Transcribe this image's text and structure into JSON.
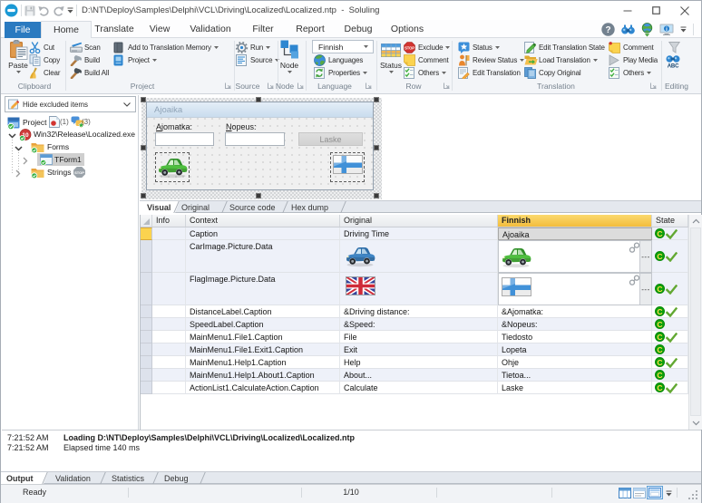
{
  "titlebar": {
    "document_path": "D:\\NT\\Deploy\\Samples\\Delphi\\VCL\\Driving\\Localized\\Localized.ntp",
    "separator": "-",
    "app_name": "Soluling",
    "qat_icons": [
      "app-logo",
      "save",
      "undo",
      "redo",
      "dropdown"
    ],
    "window_buttons": [
      "minimize",
      "maximize",
      "close"
    ]
  },
  "ribbon_tabs": {
    "items": [
      "File",
      "Home",
      "Translate",
      "View",
      "Validation",
      "Filter",
      "Report",
      "Debug",
      "Options"
    ],
    "active": "Home",
    "file_tab_color": "#2a7ac0",
    "right_icons": [
      "help",
      "find",
      "web",
      "remote-desktop",
      "dropdown"
    ]
  },
  "ribbon": {
    "groups": [
      {
        "label": "Clipboard",
        "has_launcher": false,
        "big": [
          {
            "label": "Paste",
            "icon": "paste",
            "caret": true
          }
        ],
        "buttons": [
          {
            "label": "Cut",
            "icon": "cut"
          },
          {
            "label": "Copy",
            "icon": "copy"
          },
          {
            "label": "Clear",
            "icon": "clear"
          }
        ]
      },
      {
        "label": "Project",
        "has_launcher": true,
        "buttons": [
          {
            "label": "Scan",
            "icon": "scan"
          },
          {
            "label": "Build",
            "icon": "build"
          },
          {
            "label": "Build All",
            "icon": "buildall"
          },
          {
            "label": "Add to Translation Memory",
            "icon": "tmem",
            "caret": true
          },
          {
            "label": "Project",
            "icon": "project",
            "caret": true
          }
        ]
      },
      {
        "label": "Source",
        "has_launcher": true,
        "buttons": [
          {
            "label": "Run",
            "icon": "run",
            "caret": true
          },
          {
            "label": "Source",
            "icon": "source",
            "caret": true
          }
        ]
      },
      {
        "label": "Node",
        "has_launcher": true,
        "big": [
          {
            "label": "Node",
            "icon": "node",
            "caret": true
          }
        ],
        "buttons": []
      },
      {
        "label": "Language",
        "has_launcher": true,
        "combo": {
          "value": "Finnish"
        },
        "buttons": [
          {
            "label": "Languages",
            "icon": "globe"
          },
          {
            "label": "Properties",
            "icon": "properties",
            "caret": true
          }
        ]
      },
      {
        "label": "Row",
        "has_launcher": true,
        "big": [
          {
            "label": "Status",
            "icon": "statusgrid",
            "caret": true
          }
        ],
        "buttons": [
          {
            "label": "Exclude",
            "icon": "exclude",
            "caret": true
          },
          {
            "label": "Comment",
            "icon": "comment"
          },
          {
            "label": "Others",
            "icon": "others",
            "caret": true
          }
        ]
      },
      {
        "label": "Translation",
        "has_launcher": true,
        "buttons": [
          {
            "label": "Status",
            "icon": "tstatus",
            "caret": true
          },
          {
            "label": "Review Status",
            "icon": "review",
            "caret": true
          },
          {
            "label": "Edit Translation",
            "icon": "edittrans"
          },
          {
            "label": "Edit Translation State",
            "icon": "editstate"
          },
          {
            "label": "Load Translation",
            "icon": "loadtrans",
            "caret": true
          },
          {
            "label": "Copy Original",
            "icon": "copyorig"
          },
          {
            "label": "Comment",
            "icon": "commentpin"
          },
          {
            "label": "Play Media",
            "icon": "play"
          },
          {
            "label": "Others",
            "icon": "others",
            "caret": true
          }
        ]
      },
      {
        "label": "Editing",
        "has_launcher": false,
        "buttons": [
          {
            "label": "",
            "icon": "funnel"
          },
          {
            "label": "",
            "icon": "spellcheck"
          }
        ]
      }
    ]
  },
  "left_panel": {
    "filter_combo": {
      "value": "Hide excluded items",
      "icon": "edit-pencil"
    },
    "tree": [
      {
        "label": "Project",
        "icon": "project-node",
        "badges": [
          {
            "icon": "doc-red",
            "text": "(1)"
          },
          {
            "icon": "bubbles",
            "text": "(3)"
          }
        ]
      },
      {
        "label": "Win32\\Release\\Localized.exe",
        "icon": "exe-node",
        "expander": "down"
      },
      {
        "label": "Forms",
        "icon": "folder-check",
        "expander": "down"
      },
      {
        "label": "TForm1",
        "icon": "form-node",
        "expander": "right",
        "selected": true
      },
      {
        "label": "Strings",
        "icon": "folder-check",
        "expander": "right",
        "badges": [
          {
            "icon": "stop-gray",
            "text": ""
          }
        ]
      }
    ]
  },
  "form_preview": {
    "title": "Ajoaika",
    "labels": [
      {
        "text": "Ajomatka:",
        "accel": "A"
      },
      {
        "text": "Nopeus:",
        "accel": "N"
      }
    ],
    "inputs": [
      "",
      ""
    ],
    "button": "Laske",
    "images": [
      "car-green",
      "flag-finland"
    ]
  },
  "view_tabs": {
    "items": [
      "Visual",
      "Original",
      "Source code",
      "Hex dump"
    ],
    "active": "Visual"
  },
  "grid": {
    "columns": [
      "",
      "Info",
      "Context",
      "Original",
      "Finnish",
      "State"
    ],
    "finnish_header_color": "#f5c443",
    "rows": [
      {
        "context": "Caption",
        "original": "Driving Time",
        "finnish": "Ajoaika",
        "state": [
          "translated",
          "checked"
        ],
        "current": true,
        "selected_cell": true
      },
      {
        "context": "CarImage.Picture.Data",
        "original_image": "car-blue",
        "finnish_image": "car-green",
        "state": [
          "translated",
          "checked"
        ],
        "link": true
      },
      {
        "context": "FlagImage.Picture.Data",
        "original_image": "flag-uk",
        "finnish_image": "flag-finland",
        "state": [
          "translated",
          "checked"
        ],
        "link": true
      },
      {
        "context": "DistanceLabel.Caption",
        "original": "&Driving distance:",
        "finnish": "&Ajomatka:",
        "state": [
          "translated",
          "checked"
        ]
      },
      {
        "context": "SpeedLabel.Caption",
        "original": "&Speed:",
        "finnish": "&Nopeus:",
        "state": [
          "translated"
        ]
      },
      {
        "context": "MainMenu1.File1.Caption",
        "original": "File",
        "finnish": "Tiedosto",
        "state": [
          "translated",
          "checked"
        ]
      },
      {
        "context": "MainMenu1.File1.Exit1.Caption",
        "original": "Exit",
        "finnish": "Lopeta",
        "state": [
          "translated"
        ]
      },
      {
        "context": "MainMenu1.Help1.Caption",
        "original": "Help",
        "finnish": "Ohje",
        "state": [
          "translated",
          "checked"
        ]
      },
      {
        "context": "MainMenu1.Help1.About1.Caption",
        "original": "About...",
        "finnish": "Tietoa...",
        "state": [
          "translated"
        ]
      },
      {
        "context": "ActionList1.CalculateAction.Caption",
        "original": "Calculate",
        "finnish": "Laske",
        "state": [
          "translated",
          "checked"
        ]
      }
    ]
  },
  "output": {
    "lines": [
      {
        "time": "7:21:52 AM",
        "text": "Loading D:\\NT\\Deploy\\Samples\\Delphi\\VCL\\Driving\\Localized\\Localized.ntp",
        "bold": true
      },
      {
        "time": "7:21:52 AM",
        "text": "Elapsed time 140 ms",
        "bold": false
      }
    ]
  },
  "bottom_tabs": {
    "items": [
      "Output",
      "Validation",
      "Statistics",
      "Debug"
    ],
    "active": "Output"
  },
  "statusbar": {
    "ready": "Ready",
    "position": "1/10",
    "view_icons": [
      "grid-view",
      "card-view",
      "form-view"
    ],
    "selected_view": "form-view"
  }
}
